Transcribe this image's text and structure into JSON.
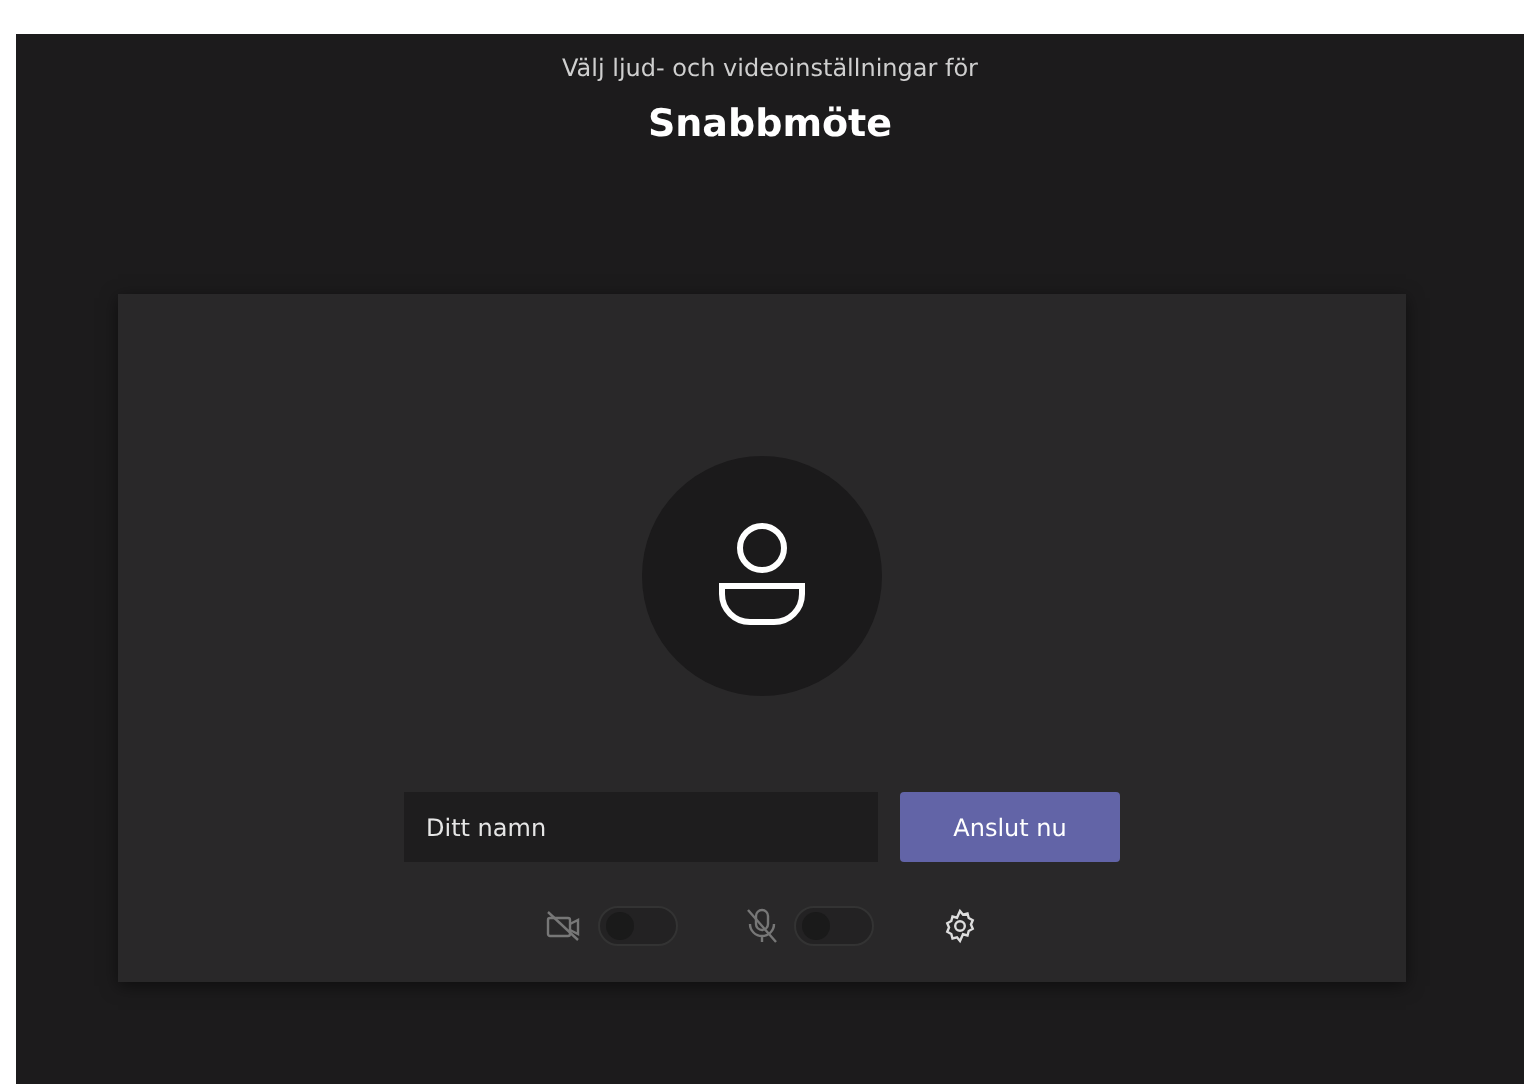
{
  "header": {
    "subtitle": "Välj ljud- och videoinställningar för",
    "title": "Snabbmöte"
  },
  "name_field": {
    "placeholder": "Ditt namn"
  },
  "join_button": "Anslut nu",
  "toggles": [
    {
      "kind": "camera",
      "on": false
    },
    {
      "kind": "microphone",
      "on": false
    }
  ]
}
